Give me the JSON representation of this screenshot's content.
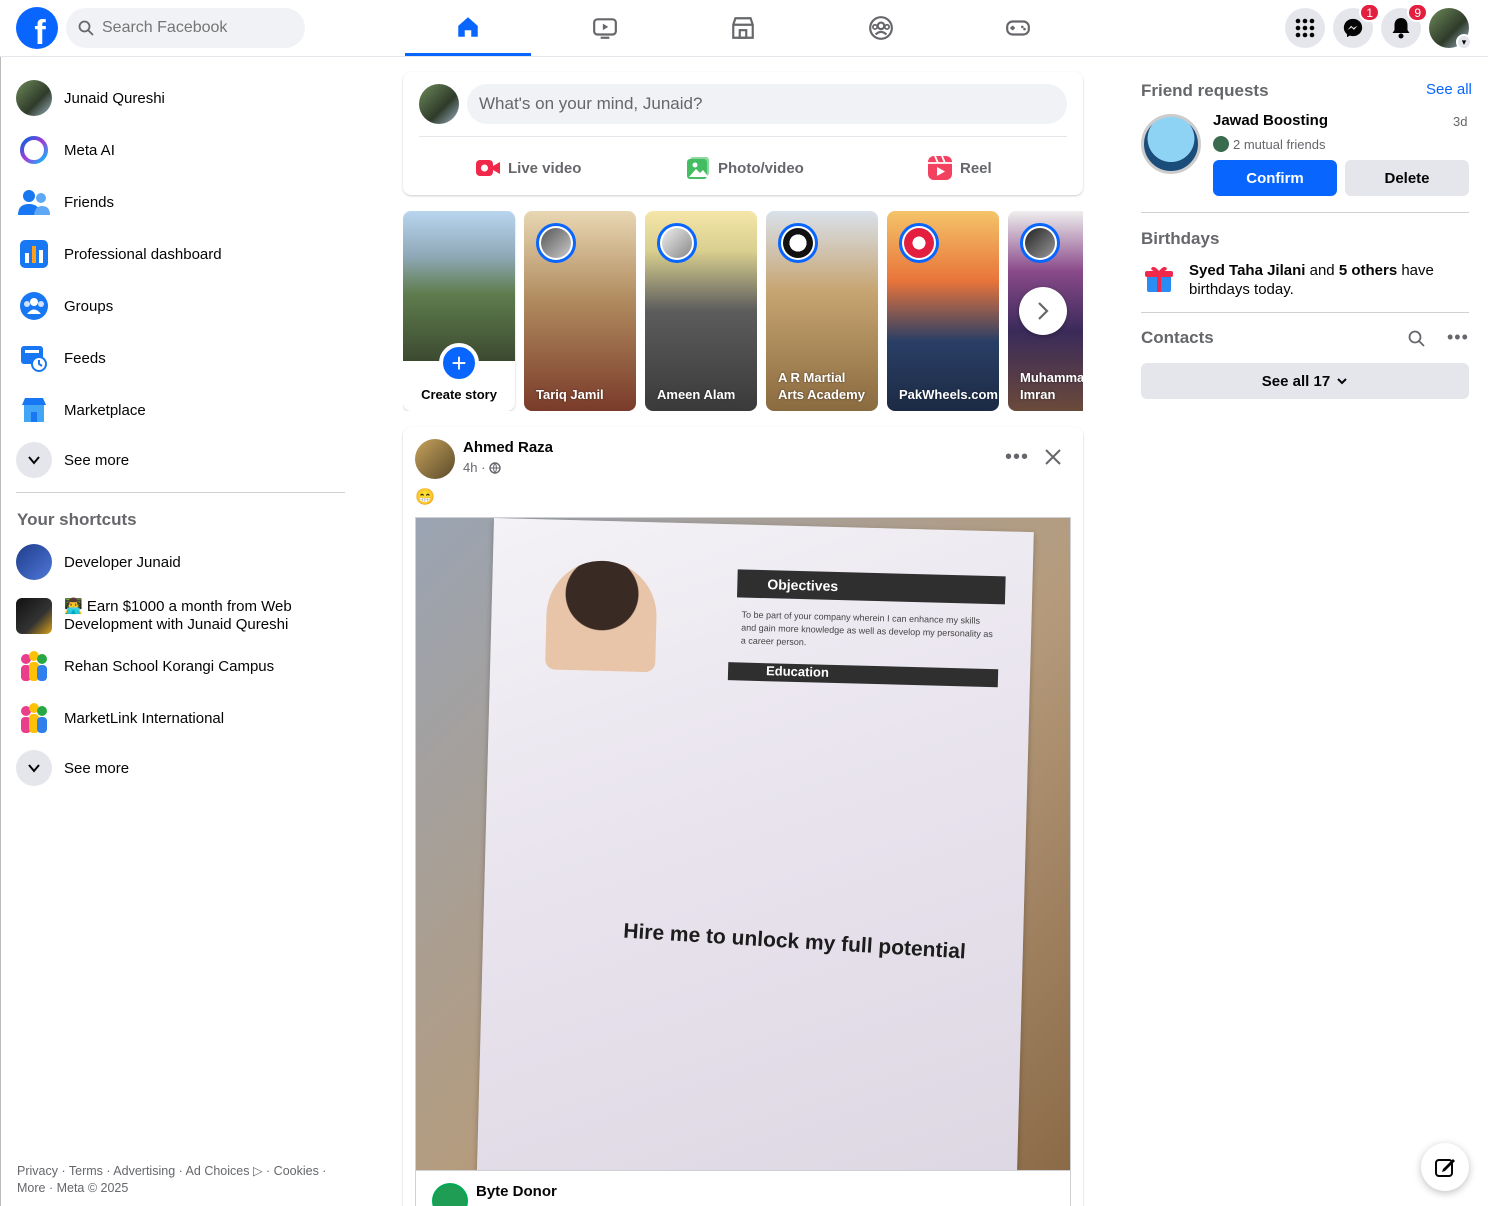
{
  "search": {
    "placeholder": "Search Facebook"
  },
  "nav": {
    "tabs": [
      "home-icon",
      "video-icon",
      "marketplace-icon",
      "groups-icon",
      "gaming-icon"
    ]
  },
  "badges": {
    "messenger": "1",
    "notifications": "9"
  },
  "sidebar": {
    "items": [
      {
        "label": "Junaid Qureshi"
      },
      {
        "label": "Meta AI"
      },
      {
        "label": "Friends"
      },
      {
        "label": "Professional dashboard"
      },
      {
        "label": "Groups"
      },
      {
        "label": "Feeds"
      },
      {
        "label": "Marketplace"
      },
      {
        "label": "See more"
      }
    ],
    "shortcuts_title": "Your shortcuts",
    "shortcuts": [
      {
        "label": "Developer Junaid"
      },
      {
        "label": "👨‍💻 Earn $1000 a month from Web Development with Junaid Qureshi"
      },
      {
        "label": "Rehan School Korangi Campus"
      },
      {
        "label": "MarketLink International"
      },
      {
        "label": "See more"
      }
    ],
    "footer": "Privacy · Terms · Advertising · Ad Choices ▷ · Cookies · More · Meta © 2025"
  },
  "composer": {
    "placeholder": "What's on your mind, Junaid?",
    "live": "Live video",
    "photo": "Photo/video",
    "reel": "Reel"
  },
  "stories": {
    "create": "Create story",
    "items": [
      {
        "name": "Tariq Jamil"
      },
      {
        "name": "Ameen Alam"
      },
      {
        "name": "A R Martial Arts Academy"
      },
      {
        "name": "PakWheels.com"
      },
      {
        "name": "Muhammad Imran"
      }
    ]
  },
  "post": {
    "author": "Ahmed Raza",
    "time": "4h ·",
    "text": "😁",
    "image_objectives": "Objectives",
    "image_objectives_text": "To be part of your company wherein I can enhance my skills and gain more knowledge as well as develop my personality as a career person.",
    "image_education": "Education",
    "image_caption": "Hire me to unlock my full potential",
    "link_name": "Byte Donor"
  },
  "right": {
    "friend_requests_title": "Friend requests",
    "see_all": "See all",
    "request": {
      "name": "Jawad Boosting",
      "time": "3d",
      "mutual": "2 mutual friends",
      "confirm": "Confirm",
      "delete": "Delete"
    },
    "birthdays_title": "Birthdays",
    "birthday": {
      "name": "Syed Taha Jilani",
      "and": " and ",
      "others": "5 others",
      "suffix": " have birthdays today."
    },
    "contacts_title": "Contacts",
    "see_all_contacts": "See all 17"
  },
  "colors": {
    "accent": "#0866ff",
    "badge": "#e41e3f",
    "text_secondary": "#65676b"
  }
}
